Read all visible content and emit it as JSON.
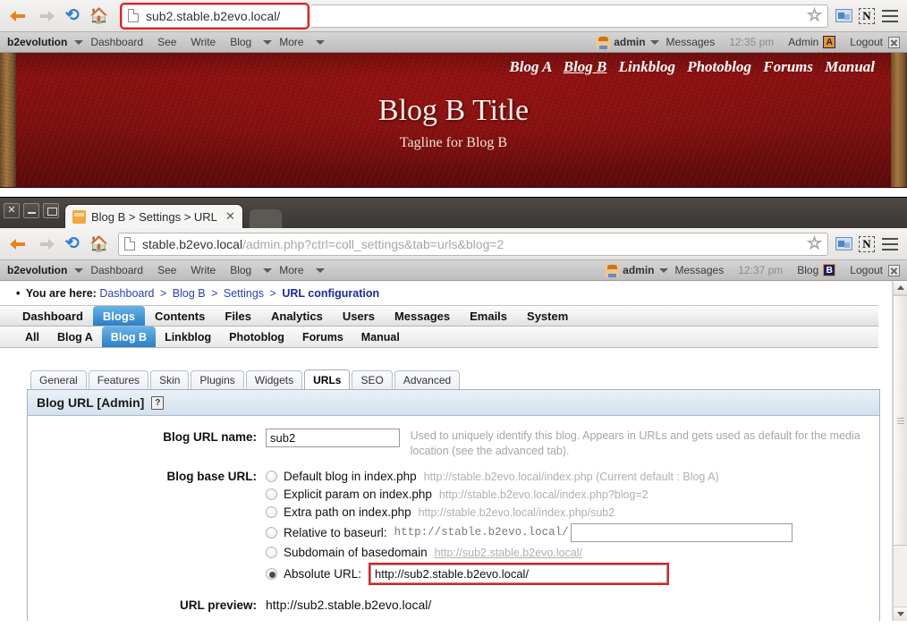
{
  "window_top": {
    "browser": {
      "back_icon": "back-arrow-icon",
      "forward_icon": "forward-arrow-icon",
      "reload_icon": "reload-icon",
      "home_icon": "home-icon",
      "url": "sub2.stable.b2evo.local/",
      "star_icon": "bookmark-star-icon",
      "screenshot_icon": "screenshot-icon",
      "note_icon": "note-icon",
      "menu_icon": "hamburger-menu-icon",
      "highlight_color": "#ee1c1c"
    },
    "evobar": {
      "brand": "b2evolution",
      "items": [
        "Dashboard",
        "See",
        "Write",
        "Blog",
        "More"
      ],
      "user": "admin",
      "messages": "Messages",
      "time": "12:35 pm",
      "admin": "Admin",
      "logout": "Logout"
    },
    "banner": {
      "links": [
        "Blog A",
        "Blog B",
        "Linkblog",
        "Photoblog",
        "Forums",
        "Manual"
      ],
      "active_link": "Blog B",
      "title": "Blog B Title",
      "tagline": "Tagline for Blog B"
    }
  },
  "window_bottom": {
    "titlebar": {
      "close": "✕",
      "minimize": "–",
      "maximize": "□",
      "tab_title": "Blog B > Settings > URL cᴏ",
      "tab_close": "✕"
    },
    "browser": {
      "url_host": "stable.b2evo.local",
      "url_path": "/admin.php?ctrl=coll_settings&tab=urls&blog=2",
      "star_icon": "bookmark-star-icon",
      "screenshot_icon": "screenshot-icon",
      "note_icon": "note-icon",
      "menu_icon": "hamburger-menu-icon"
    },
    "evobar": {
      "brand": "b2evolution",
      "items": [
        "Dashboard",
        "See",
        "Write",
        "Blog",
        "More"
      ],
      "user": "admin",
      "messages": "Messages",
      "time": "12:37 pm",
      "blog": "Blog",
      "blog_badge": "B",
      "logout": "Logout"
    },
    "breadcrumb": {
      "prefix": "You are here:",
      "items": [
        "Dashboard",
        "Blog B",
        "Settings"
      ],
      "current": "URL configuration",
      "separator": ">"
    },
    "mainnav": {
      "items": [
        "Dashboard",
        "Blogs",
        "Contents",
        "Files",
        "Analytics",
        "Users",
        "Messages",
        "Emails",
        "System"
      ],
      "active": "Blogs"
    },
    "subnav": {
      "items": [
        "All",
        "Blog A",
        "Blog B",
        "Linkblog",
        "Photoblog",
        "Forums",
        "Manual"
      ],
      "active": "Blog B"
    },
    "settings_tabs": {
      "items": [
        "General",
        "Features",
        "Skin",
        "Plugins",
        "Widgets",
        "URLs",
        "SEO",
        "Advanced"
      ],
      "active": "URLs"
    },
    "panel": {
      "title": "Blog URL [Admin]",
      "help_icon": "help-book-icon",
      "url_name": {
        "label": "Blog URL name:",
        "value": "sub2",
        "hint": "Used to uniquely identify this blog. Appears in URLs and gets used as default for the media location (see the advanced tab)."
      },
      "base_url": {
        "label": "Blog base URL:",
        "options": [
          {
            "id": "default-blog-index",
            "label": "Default blog in index.php",
            "url": "http://stable.b2evo.local/index.php (Current default : Blog A)",
            "checked": false,
            "mono": false,
            "has_input": false
          },
          {
            "id": "explicit-param-index",
            "label": "Explicit param on index.php",
            "url": "http://stable.b2evo.local/index.php?blog=2",
            "checked": false,
            "mono": false,
            "has_input": false
          },
          {
            "id": "extra-path-index",
            "label": "Extra path on index.php",
            "url": "http://stable.b2evo.local/index.php/sub2",
            "checked": false,
            "mono": false,
            "has_input": false
          },
          {
            "id": "relative-to-baseurl",
            "label": "Relative to baseurl:",
            "url": "http://stable.b2evo.local/",
            "checked": false,
            "mono": true,
            "has_input": true,
            "input_value": "",
            "input_width": 248,
            "input_red": false
          },
          {
            "id": "subdomain-of-basedomain",
            "label": "Subdomain of basedomain",
            "url": "http://sub2.stable.b2evo.local/",
            "checked": false,
            "mono": false,
            "underline": true,
            "has_input": false
          },
          {
            "id": "absolute-url",
            "label": "Absolute URL:",
            "url": "",
            "checked": true,
            "mono": false,
            "has_input": true,
            "input_value": "http://sub2.stable.b2evo.local/",
            "input_width": 332,
            "input_red": true
          }
        ]
      },
      "url_preview": {
        "label": "URL preview:",
        "value": "http://sub2.stable.b2evo.local/"
      }
    }
  }
}
